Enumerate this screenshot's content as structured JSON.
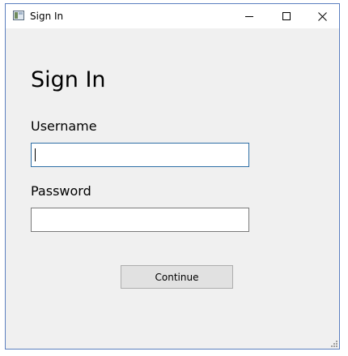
{
  "window": {
    "title": "Sign In",
    "icons": {
      "app": "app-icon",
      "minimize": "minimize-icon",
      "maximize": "maximize-icon",
      "close": "close-icon",
      "resize": "resize-grip-icon"
    }
  },
  "form": {
    "heading": "Sign In",
    "username": {
      "label": "Username",
      "value": "",
      "placeholder": ""
    },
    "password": {
      "label": "Password",
      "value": "",
      "placeholder": ""
    },
    "submit_label": "Continue"
  },
  "colors": {
    "window_border": "#5b7fbf",
    "focus_border": "#2f6fa6",
    "client_bg": "#f0f0f0",
    "button_bg": "#e1e1e1"
  }
}
